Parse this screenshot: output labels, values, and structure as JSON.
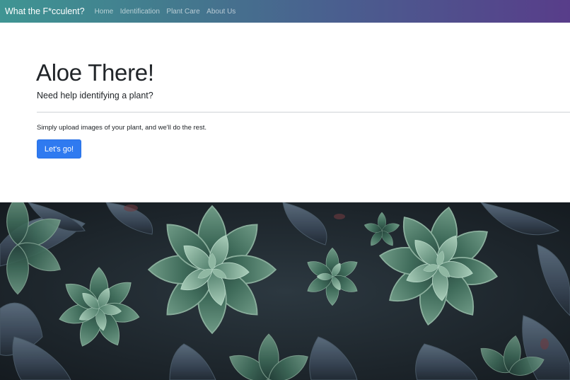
{
  "navbar": {
    "brand": "What the F*cculent?",
    "links": [
      "Home",
      "Identification",
      "Plant Care",
      "About Us"
    ],
    "gradient_start": "#3f9593",
    "gradient_end": "#583d8a"
  },
  "hero": {
    "title": "Aloe There!",
    "lead": "Need help identifying a plant?",
    "text": "Simply upload images of your plant, and we'll do the rest.",
    "button_label": "Let's go!",
    "button_color": "#2f7af0"
  },
  "photo": {
    "subject": "succulent rosettes photograph"
  }
}
